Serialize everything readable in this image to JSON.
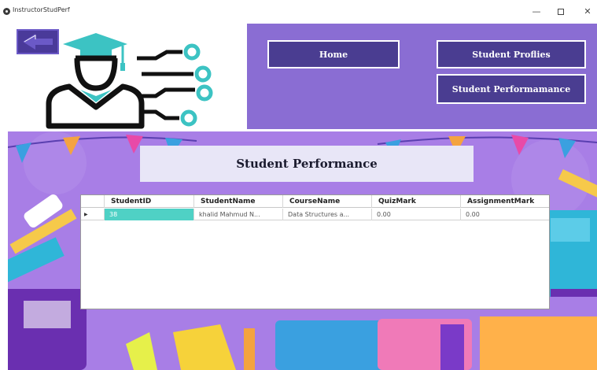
{
  "window": {
    "title": "InstructorStudPerf",
    "minimize": "—",
    "close": "✕"
  },
  "nav": {
    "home": "Home",
    "profiles": "Student Proflies",
    "performance": "Student Performamance"
  },
  "page": {
    "heading": "Student Performance"
  },
  "table": {
    "columns": [
      "StudentID",
      "StudentName",
      "CourseName",
      "QuizMark",
      "AssignmentMark"
    ],
    "rows": [
      [
        "38",
        "khalid Mahmud N...",
        "Data Structures a...",
        "0.00",
        "0.00"
      ]
    ]
  },
  "colors": {
    "nav_panel": "#8a6dd3",
    "nav_button": "#4a3d91",
    "background": "#a87ee6",
    "selected_cell": "#4fd1c5"
  },
  "icons": [
    "app-icon",
    "back-arrow-icon",
    "graduate-icon",
    "minimize-icon",
    "maximize-icon",
    "close-icon"
  ]
}
